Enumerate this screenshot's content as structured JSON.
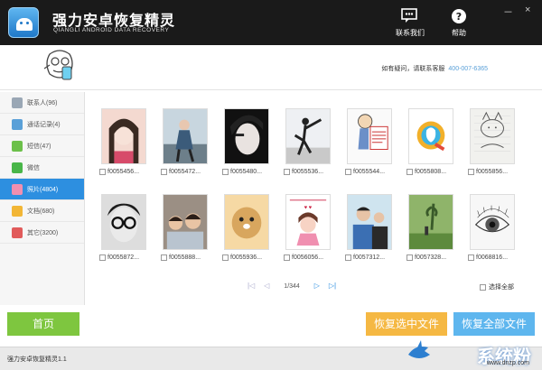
{
  "titlebar": {
    "title": "强力安卓恢复精灵",
    "subtitle": "QIANGLI ANDROID DATA RECOVERY",
    "contact_label": "联系我们",
    "help_label": "帮助",
    "minimize": "－",
    "close": "×"
  },
  "header": {
    "contact_text": "如有疑问，请联系客服",
    "phone": "400-007-6365"
  },
  "sidebar": {
    "items": [
      {
        "label": "联系人(96)",
        "icon": "contacts-icon",
        "color": "#9aa7b5"
      },
      {
        "label": "通话记录(4)",
        "icon": "call-log-icon",
        "color": "#5aa0d8"
      },
      {
        "label": "短信(47)",
        "icon": "sms-icon",
        "color": "#6cc04a"
      },
      {
        "label": "微信",
        "icon": "wechat-icon",
        "color": "#49b649"
      },
      {
        "label": "照片(4804)",
        "icon": "photo-icon",
        "color": "#f08fb0"
      },
      {
        "label": "文档(680)",
        "icon": "document-icon",
        "color": "#f2b636"
      },
      {
        "label": "其它(3200)",
        "icon": "other-icon",
        "color": "#e15b5b"
      }
    ],
    "active_index": 4
  },
  "photos": [
    {
      "name": "f0055456..."
    },
    {
      "name": "f0055472..."
    },
    {
      "name": "f0055480..."
    },
    {
      "name": "f0055536..."
    },
    {
      "name": "f0055544..."
    },
    {
      "name": "f0055808..."
    },
    {
      "name": "f0055856..."
    },
    {
      "name": "f0055872..."
    },
    {
      "name": "f0055888..."
    },
    {
      "name": "f0055936..."
    },
    {
      "name": "f0056056..."
    },
    {
      "name": "f0057312..."
    },
    {
      "name": "f0057328..."
    },
    {
      "name": "f0068816..."
    }
  ],
  "pager": {
    "first": "|◁",
    "prev": "◁",
    "page": "1/344",
    "next": "▷",
    "last": "▷|"
  },
  "select_all_label": "选择全部",
  "buttons": {
    "home": "首页",
    "recover_selected": "恢复选中文件",
    "recover_all": "恢复全部文件"
  },
  "status": {
    "version": "强力安卓恢复精灵1.1"
  },
  "watermark": {
    "main": "系统粉",
    "sub": "www.dnzp.com"
  }
}
